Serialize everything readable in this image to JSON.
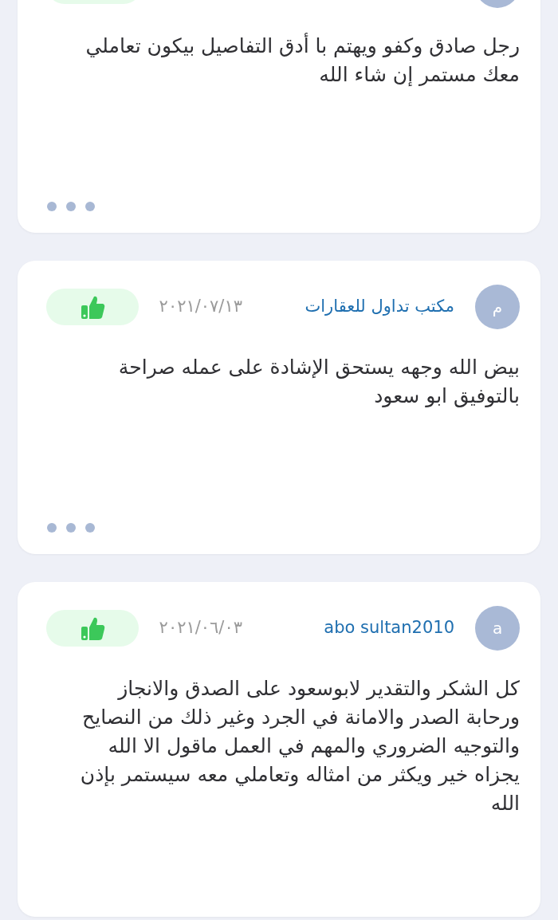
{
  "reviews": [
    {
      "liked": true,
      "comment": "رجل صادق وكفو ويهتم با أدق التفاصيل بيكون تعاملي معك مستمر إن شاء الله",
      "more_menu": true
    },
    {
      "avatar_letter": "م",
      "author": "مكتب تداول للعقارات",
      "date": "٢٠٢١/٠٧/١٣",
      "liked": true,
      "comment": "بيض الله وجهه يستحق الإشادة على عمله صراحة بالتوفيق ابو سعود",
      "more_menu": true
    },
    {
      "avatar_letter": "a",
      "author": "abo sultan2010",
      "date": "٢٠٢١/٠٦/٠٣",
      "liked": true,
      "comment": "كل الشكر والتقدير لابوسعود على الصدق والانجاز ورحابة الصدر والامانة في الجرد وغير ذلك من النصايح والتوجيه الضروري والمهم في العمل ماقول الا الله يجزاه خير ويكثر من امثاله وتعاملي معه سيستمر بإذن الله",
      "more_menu": false
    }
  ]
}
